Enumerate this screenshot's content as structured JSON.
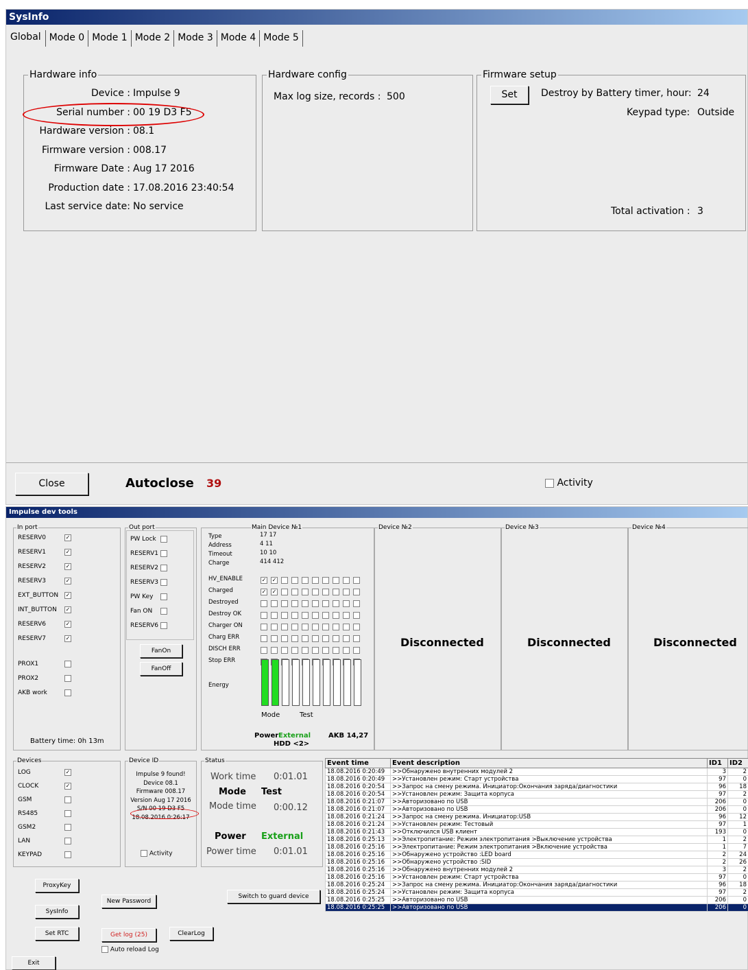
{
  "sysinfo": {
    "title": "SysInfo",
    "tabs": [
      "Global",
      "Mode 0",
      "Mode 1",
      "Mode 2",
      "Mode 3",
      "Mode 4",
      "Mode 5"
    ],
    "hw_info": {
      "legend": "Hardware info",
      "rows": [
        {
          "label": "Device :",
          "value": "Impulse 9"
        },
        {
          "label": "Serial number :",
          "value": "00 19 D3 F5"
        },
        {
          "label": "Hardware version :",
          "value": "08.1"
        },
        {
          "label": "Firmware version :",
          "value": "008.17"
        },
        {
          "label": "Firmware Date :",
          "value": "Aug 17 2016"
        },
        {
          "label": "Production date :",
          "value": "17.08.2016 23:40:54"
        },
        {
          "label": "Last service date:",
          "value": "No service"
        }
      ]
    },
    "hw_config": {
      "legend": "Hardware config",
      "max_log": "Max log size, records :",
      "max_log_value": "500"
    },
    "fw_setup": {
      "legend": "Firmware setup",
      "set": "Set",
      "destroy": "Destroy by Battery timer, hour:",
      "destroy_value": "24",
      "keypad": "Keypad type:",
      "keypad_value": "Outside",
      "total": "Total activation :",
      "total_value": "3"
    },
    "close": "Close",
    "autoclose": "Autoclose",
    "autoclose_value": "39",
    "activity": "Activity"
  },
  "devtools": {
    "title": "Impulse dev tools",
    "in_port": {
      "legend": "In port",
      "items": [
        {
          "label": "RESERV0",
          "checked": true
        },
        {
          "label": "RESERV1",
          "checked": true
        },
        {
          "label": "RESERV2",
          "checked": true
        },
        {
          "label": "RESERV3",
          "checked": true
        },
        {
          "label": "EXT_BUTTON",
          "checked": true
        },
        {
          "label": "INT_BUTTON",
          "checked": true
        },
        {
          "label": "RESERV6",
          "checked": true
        },
        {
          "label": "RESERV7",
          "checked": true
        },
        {
          "label": "PROX1",
          "checked": false
        },
        {
          "label": "PROX2",
          "checked": false
        },
        {
          "label": "AKB work",
          "checked": false
        }
      ],
      "battery": "Battery time: 0h 13m"
    },
    "out_port": {
      "legend": "Out port",
      "items": [
        {
          "label": "PW Lock",
          "checked": false
        },
        {
          "label": "RESERV1",
          "checked": false
        },
        {
          "label": "RESERV2",
          "checked": false
        },
        {
          "label": "RESERV3",
          "checked": false
        },
        {
          "label": "PW Key",
          "checked": false
        },
        {
          "label": "Fan ON",
          "checked": false
        },
        {
          "label": "RESERV6",
          "checked": false
        }
      ],
      "fan_on": "FanOn",
      "fan_off": "FanOff"
    },
    "main_device": {
      "legend": "Main Device №1",
      "labels": [
        "Type",
        "Address",
        "Timeout",
        "Charge",
        "HV_ENABLE",
        "Charged",
        "Destroyed",
        "Destroy OK",
        "Charger ON",
        "Charg ERR",
        "DISCH ERR",
        "Stop ERR",
        "Energy"
      ],
      "values": [
        "17  17",
        "4   11",
        "10  10",
        "414 412"
      ],
      "hv_enable": [
        true,
        true,
        false,
        false,
        false,
        false,
        false,
        false,
        false,
        false
      ],
      "charged": [
        true,
        true,
        false,
        false,
        false,
        false,
        false,
        false,
        false,
        false
      ],
      "energy_on": [
        true,
        true,
        false,
        false,
        false,
        false,
        false,
        false,
        false,
        false
      ],
      "mode_label": "Mode",
      "mode_value": "Test",
      "power_label": "Power",
      "power_value": "External",
      "akb": "AKB 14,27",
      "hdd": "HDD  <2>"
    },
    "devices_ext": [
      {
        "legend": "Device №2",
        "status": "Disconnected"
      },
      {
        "legend": "Device №3",
        "status": "Disconnected"
      },
      {
        "legend": "Device №4",
        "status": "Disconnected"
      }
    ],
    "devices": {
      "legend": "Devices",
      "items": [
        {
          "label": "LOG",
          "checked": true
        },
        {
          "label": "CLOCK",
          "checked": true
        },
        {
          "label": "GSM",
          "checked": false
        },
        {
          "label": "RS485",
          "checked": false
        },
        {
          "label": "GSM2",
          "checked": false
        },
        {
          "label": "LAN",
          "checked": false
        },
        {
          "label": "KEYPAD",
          "checked": false
        }
      ]
    },
    "device_id": {
      "legend": "Device ID",
      "lines": [
        "Impulse 9 found!",
        "Device    08.1",
        "Firmware    008.17",
        "Version  Aug 17 2016",
        "S/N  00 19 D3 F5",
        "18.08.2016 0:26:17"
      ],
      "activity": "Activity"
    },
    "status": {
      "legend": "Status",
      "work_time": "Work time",
      "work_value": "0:01.01",
      "mode": "Mode",
      "mode_value": "Test",
      "mode_time": "Mode time",
      "mode_time_value": "0:00.12",
      "power": "Power",
      "power_value": "External",
      "power_time": "Power time",
      "power_time_value": "0:01.01"
    },
    "buttons": {
      "proxykey": "ProxyKey",
      "new_password": "New Password",
      "switch_guard": "Switch to guard device",
      "sysinfo": "SysInfo",
      "set_rtc": "Set RTC",
      "get_log": "Get log (25)",
      "clear_log": "ClearLog",
      "auto_reload": "Auto reload Log",
      "exit": "Exit"
    },
    "log": {
      "headers": [
        "Event time",
        "Event description",
        "ID1",
        "ID2"
      ],
      "rows": [
        [
          "18.08.2016 0:20:49",
          ">>Обнаружено внутренних модулей 2",
          "3",
          "2"
        ],
        [
          "18.08.2016 0:20:49",
          ">>Установлен режим: Старт устройства",
          "97",
          "0"
        ],
        [
          "18.08.2016 0:20:54",
          ">>Запрос на смену режима. Инициатор:Окончания заряда/диагностики",
          "96",
          "18"
        ],
        [
          "18.08.2016 0:20:54",
          ">>Установлен режим: Защита корпуса",
          "97",
          "2"
        ],
        [
          "18.08.2016 0:21:07",
          ">>Авторизовано по USB",
          "206",
          "0"
        ],
        [
          "18.08.2016 0:21:07",
          ">>Авторизовано по USB",
          "206",
          "0"
        ],
        [
          "18.08.2016 0:21:24",
          ">>Запрос на смену режима. Инициатор:USB",
          "96",
          "12"
        ],
        [
          "18.08.2016 0:21:24",
          ">>Установлен режим: Тестовый",
          "97",
          "1"
        ],
        [
          "18.08.2016 0:21:43",
          ">>Отключился USB клиент",
          "193",
          "0"
        ],
        [
          "18.08.2016 0:25:13",
          ">>Электропитание: Режим электропитания >Выключение устройства",
          "1",
          "2"
        ],
        [
          "18.08.2016 0:25:16",
          ">>Электропитание: Режим электропитания >Включение устройства",
          "1",
          "7"
        ],
        [
          "18.08.2016 0:25:16",
          ">>Обнаружено устройство :LED board",
          "2",
          "24"
        ],
        [
          "18.08.2016 0:25:16",
          ">>Обнаружено устройство :SID",
          "2",
          "26"
        ],
        [
          "18.08.2016 0:25:16",
          ">>Обнаружено внутренних модулей 2",
          "3",
          "2"
        ],
        [
          "18.08.2016 0:25:16",
          ">>Установлен режим: Старт устройства",
          "97",
          "0"
        ],
        [
          "18.08.2016 0:25:24",
          ">>Запрос на смену режима. Инициатор:Окончания заряда/диагностики",
          "96",
          "18"
        ],
        [
          "18.08.2016 0:25:24",
          ">>Установлен режим: Защита корпуса",
          "97",
          "2"
        ],
        [
          "18.08.2016 0:25:25",
          ">>Авторизовано по USB",
          "206",
          "0"
        ],
        [
          "18.08.2016 0:25:25",
          ">>Авторизовано по USB",
          "206",
          "0"
        ]
      ]
    }
  }
}
